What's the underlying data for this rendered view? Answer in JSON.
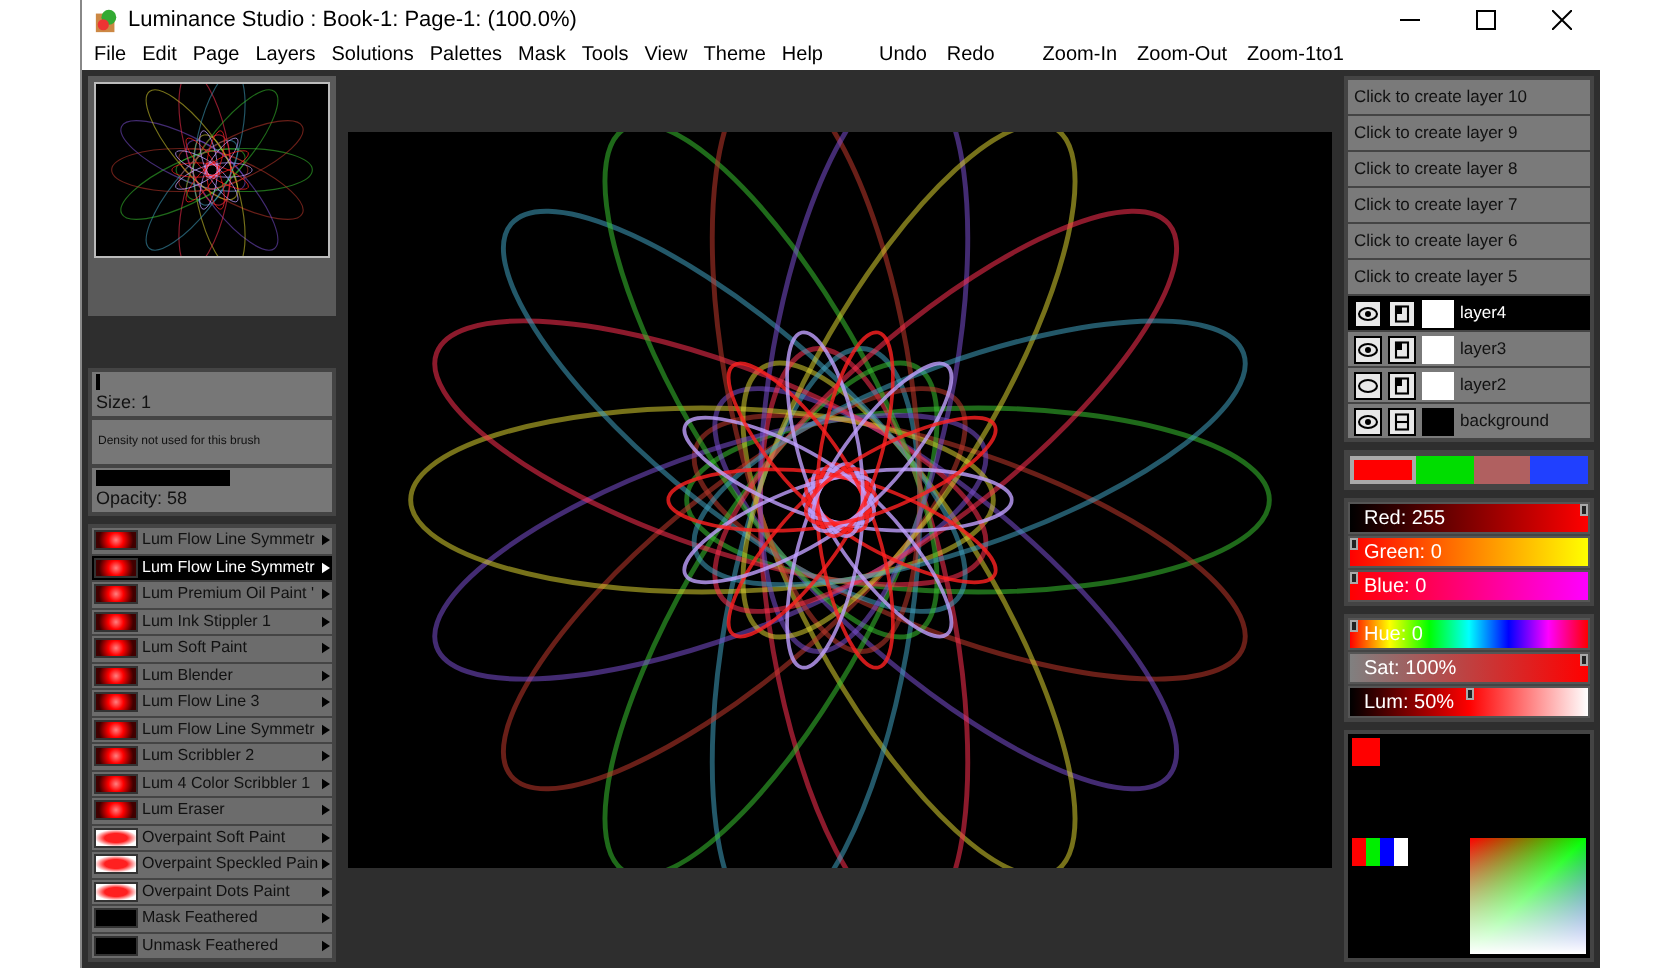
{
  "window": {
    "title": "Luminance Studio : Book-1: Page-1:  (100.0%)"
  },
  "menu": [
    "File",
    "Edit",
    "Page",
    "Layers",
    "Solutions",
    "Palettes",
    "Mask",
    "Tools",
    "View",
    "Theme",
    "Help"
  ],
  "toolbar": [
    "Undo",
    "Redo",
    "Zoom-In",
    "Zoom-Out",
    "Zoom-1to1"
  ],
  "brush_settings": {
    "size": {
      "label": "Size: 1",
      "level": 0
    },
    "density_note": "Density not used for this brush",
    "opacity": {
      "label": "Opacity: 58",
      "level": 0.58
    }
  },
  "brushes": [
    {
      "name": "Lum Flow Line Symmetr",
      "kind": "lum",
      "selected": false
    },
    {
      "name": "Lum Flow Line Symmetr",
      "kind": "lum",
      "selected": true
    },
    {
      "name": "Lum Premium Oil Paint '",
      "kind": "lum",
      "selected": false
    },
    {
      "name": "Lum Ink Stippler 1",
      "kind": "lum",
      "selected": false
    },
    {
      "name": "Lum Soft Paint",
      "kind": "lum",
      "selected": false
    },
    {
      "name": "Lum Blender",
      "kind": "lum",
      "selected": false
    },
    {
      "name": "Lum Flow Line 3",
      "kind": "lum",
      "selected": false
    },
    {
      "name": "Lum Flow Line Symmetr",
      "kind": "lum",
      "selected": false
    },
    {
      "name": "Lum Scribbler 2",
      "kind": "lum",
      "selected": false
    },
    {
      "name": "Lum 4 Color Scribbler 1",
      "kind": "lum",
      "selected": false
    },
    {
      "name": "Lum Eraser",
      "kind": "lum",
      "selected": false
    },
    {
      "name": "Overpaint Soft Paint",
      "kind": "overpaint",
      "selected": false
    },
    {
      "name": "Overpaint Speckled Pain",
      "kind": "overpaint",
      "selected": false
    },
    {
      "name": "Overpaint Dots Paint",
      "kind": "overpaint",
      "selected": false
    },
    {
      "name": "Mask Feathered",
      "kind": "mask",
      "selected": false
    },
    {
      "name": "Unmask Feathered",
      "kind": "mask",
      "selected": false
    }
  ],
  "layers": {
    "create_buttons": [
      "Click to create layer 10",
      "Click to create layer 9",
      "Click to create layer 8",
      "Click to create layer 7",
      "Click to create layer 6",
      "Click to create layer 5"
    ],
    "items": [
      {
        "name": "layer4",
        "visible": true,
        "locked": false,
        "selected": true
      },
      {
        "name": "layer3",
        "visible": true,
        "locked": false,
        "selected": false
      },
      {
        "name": "layer2",
        "visible": false,
        "locked": false,
        "selected": false
      },
      {
        "name": "background",
        "visible": true,
        "locked": true,
        "selected": false
      }
    ]
  },
  "swatches": [
    {
      "color": "#ff0000",
      "selected": true
    },
    {
      "color": "#00dd00",
      "selected": false
    },
    {
      "color": "#b06060",
      "selected": false
    },
    {
      "color": "#2040ff",
      "selected": false
    }
  ],
  "sliders": [
    {
      "label": "Red: 255",
      "kind": "red",
      "level": 1
    },
    {
      "label": "Green: 0",
      "kind": "green",
      "level": 0
    },
    {
      "label": "Blue: 0",
      "kind": "blue",
      "level": 0
    }
  ],
  "hsl_sliders": [
    {
      "label": "Hue: 0",
      "kind": "hue",
      "level": 0
    },
    {
      "label": "Sat: 100%",
      "kind": "sat",
      "level": 1
    },
    {
      "label": "Lum: 50%",
      "kind": "lum",
      "level": 0.5
    }
  ],
  "mixer": {
    "swatches": [
      {
        "kind": "current",
        "color": "#ff0000"
      },
      {
        "kind": "palette",
        "color": "#ff0000"
      },
      {
        "kind": "palette",
        "color": "#00ee00"
      },
      {
        "kind": "palette",
        "color": "#0000ff"
      },
      {
        "kind": "palette",
        "color": "#ffffff"
      }
    ]
  }
}
